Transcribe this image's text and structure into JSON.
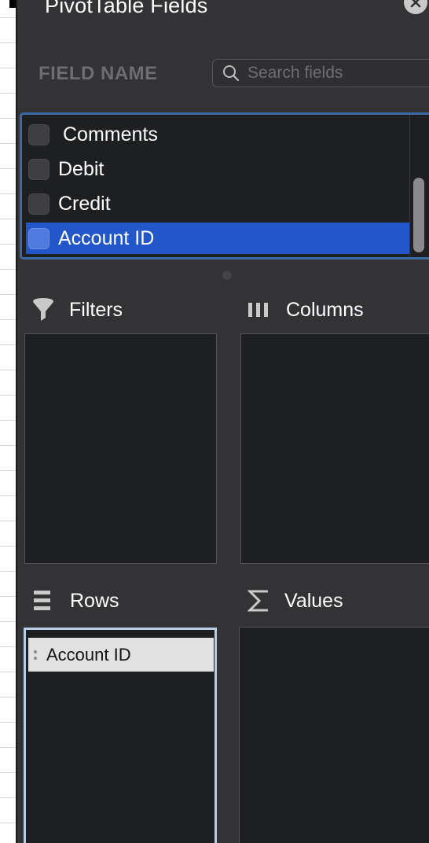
{
  "panel": {
    "title": "PivotTable Fields",
    "field_name_label": "FIELD NAME",
    "search_placeholder": "Search fields"
  },
  "fields": [
    {
      "label": "Comments",
      "checked": false,
      "selected": false
    },
    {
      "label": "Debit",
      "checked": false,
      "selected": false
    },
    {
      "label": "Credit",
      "checked": false,
      "selected": false
    },
    {
      "label": "Account ID",
      "checked": false,
      "selected": true
    }
  ],
  "areas": {
    "filters": {
      "label": "Filters",
      "icon": "filter-icon"
    },
    "columns": {
      "label": "Columns",
      "icon": "columns-icon"
    },
    "rows": {
      "label": "Rows",
      "icon": "rows-icon",
      "items": [
        "Account ID"
      ]
    },
    "values": {
      "label": "Values",
      "icon": "sigma-icon"
    }
  },
  "colors": {
    "panel_bg": "#333335",
    "list_bg": "#1e1f21",
    "selection": "#2256c9",
    "focus_ring": "#3c6aa6"
  }
}
